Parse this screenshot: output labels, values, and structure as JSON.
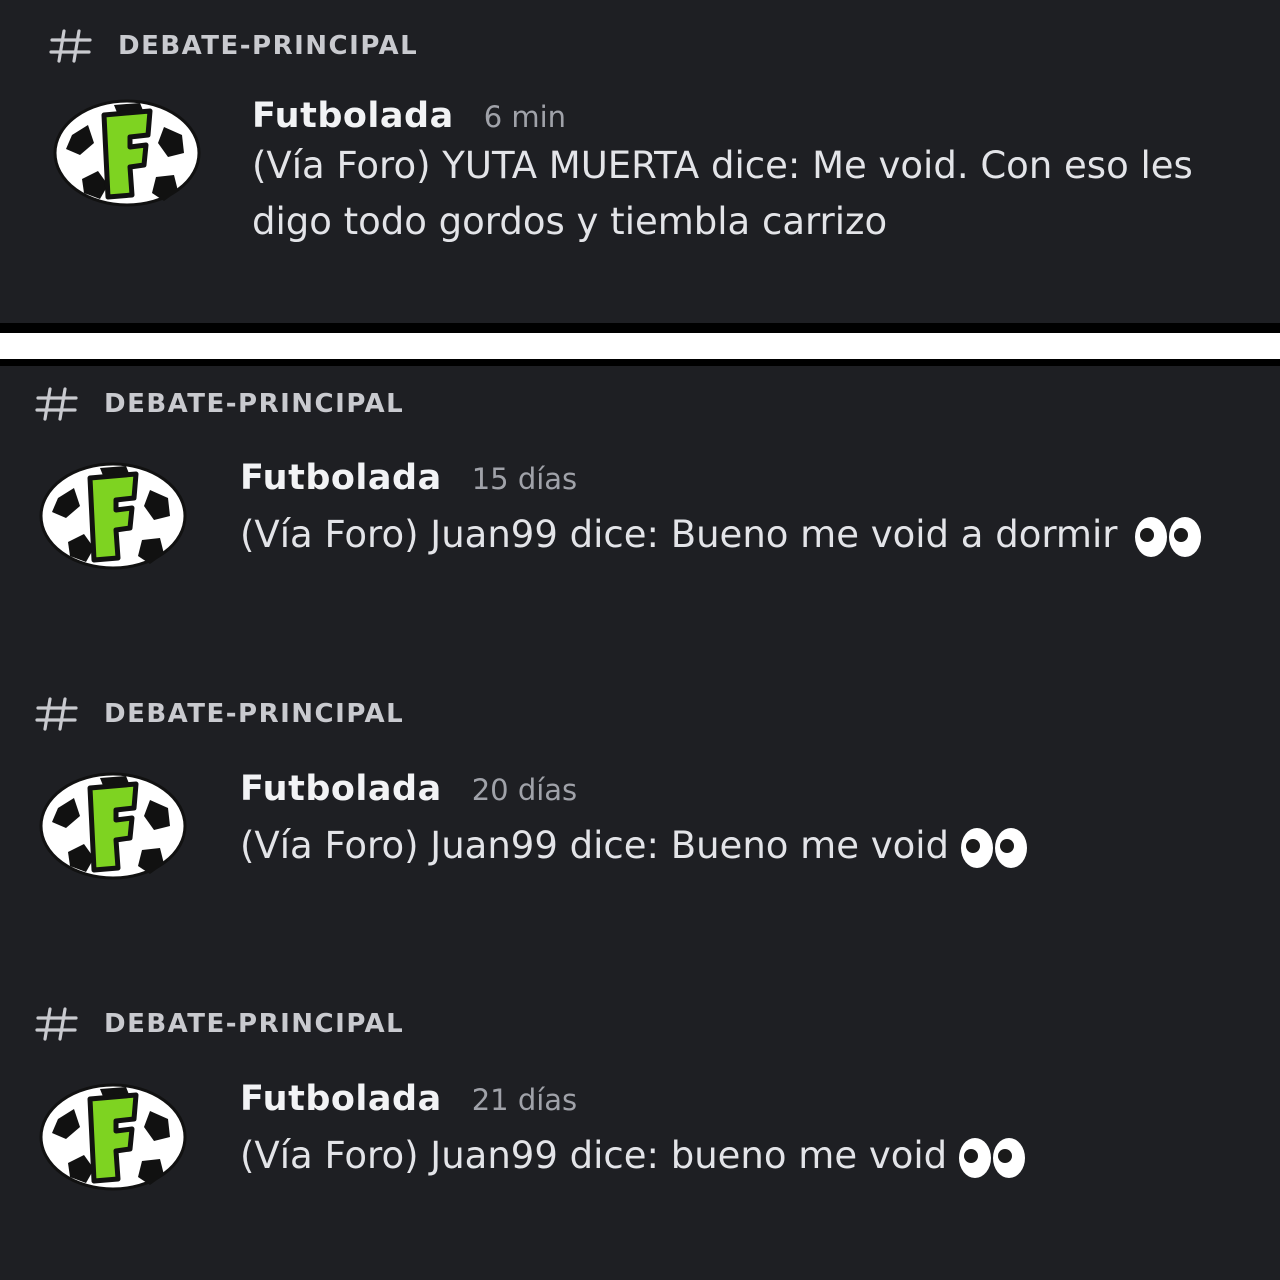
{
  "posts": [
    {
      "channel": "DEBATE-PRINCIPAL",
      "author": "Futbolada",
      "time": "6 min",
      "text": "(Vía Foro) YUTA MUERTA dice: Me void. Con eso les digo todo gordos y tiembla carrizo",
      "has_eyes_emoji": false
    },
    {
      "channel": "DEBATE-PRINCIPAL",
      "author": "Futbolada",
      "time": "15 días",
      "text": "(Vía Foro) Juan99 dice: Bueno me void a dormir",
      "has_eyes_emoji": true
    },
    {
      "channel": "DEBATE-PRINCIPAL",
      "author": "Futbolada",
      "time": "20 días",
      "text": "(Vía Foro) Juan99 dice: Bueno me void",
      "has_eyes_emoji": true
    },
    {
      "channel": "DEBATE-PRINCIPAL",
      "author": "Futbolada",
      "time": "21 días",
      "text": "(Vía Foro) Juan99 dice: bueno me void",
      "has_eyes_emoji": true
    }
  ],
  "colors": {
    "background": "#1e1f23",
    "logo_green": "#7ed321"
  },
  "icons": {
    "channel": "hash-icon",
    "avatar": "soccer-ball-logo",
    "emoji": "eyes-emoji"
  }
}
